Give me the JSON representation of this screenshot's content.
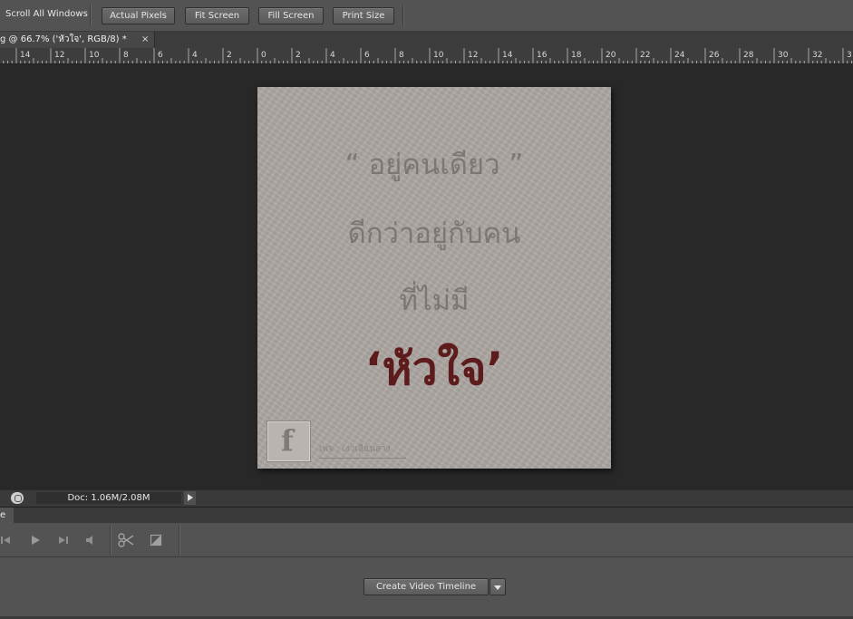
{
  "options_bar": {
    "scroll_all_windows": "Scroll All Windows",
    "buttons": [
      "Actual Pixels",
      "Fit Screen",
      "Fill Screen",
      "Print Size"
    ]
  },
  "document_tab": {
    "title": "g @ 66.7% ('หัวใจ', RGB/8) *",
    "close": "×"
  },
  "ruler": {
    "labels": [
      "14",
      "12",
      "10",
      "8",
      "6",
      "4",
      "2",
      "0",
      "2",
      "4",
      "6",
      "8",
      "10",
      "12",
      "14",
      "16",
      "18",
      "20",
      "22",
      "24",
      "26",
      "28",
      "30",
      "32",
      "3"
    ]
  },
  "artwork": {
    "line1": "“ อยู่คนเดียว ”",
    "line2": "ดีกว่าอยู่กับคน",
    "line3": "ที่ไม่มี",
    "line4": "‘หัวใจ’",
    "fb_glyph": "f",
    "credit": "เพจ : เงาเลือนลาง",
    "accent_color": "#5e1b1b"
  },
  "status_bar": {
    "doc_size": "Doc: 1.06M/2.08M"
  },
  "timeline": {
    "tab_label": "e",
    "create_button": "Create Video Timeline"
  }
}
